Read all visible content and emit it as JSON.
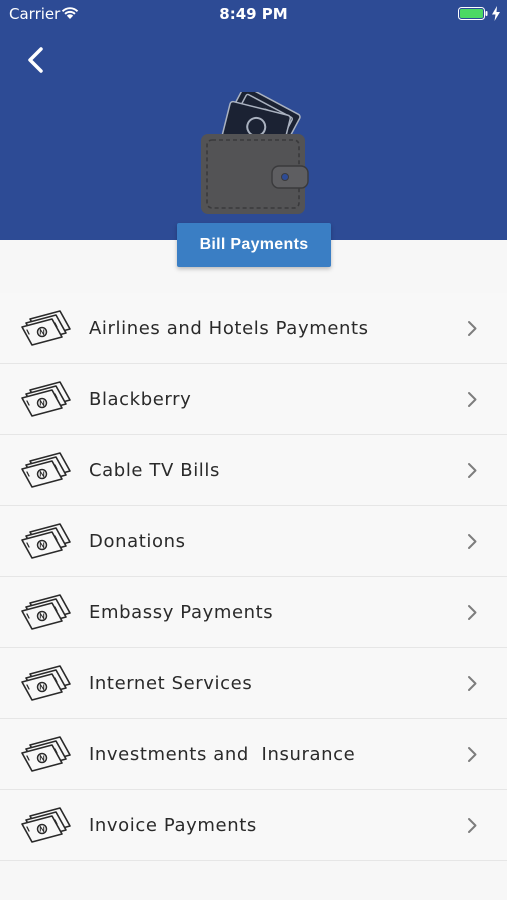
{
  "status_bar": {
    "carrier": "Carrier",
    "time": "8:49 PM",
    "battery_color": "#4cd964"
  },
  "header": {
    "background_color": "#2d4b95",
    "back_icon": "chevron-left-icon",
    "hero_icon": "wallet-icon",
    "title": "Bill Payments",
    "title_button_color": "#3a7ec4"
  },
  "list": {
    "item_icon": "money-bills-icon",
    "trailing_icon": "chevron-right-icon",
    "items": [
      {
        "label": "Airlines and Hotels Payments"
      },
      {
        "label": "Blackberry"
      },
      {
        "label": "Cable TV Bills"
      },
      {
        "label": "Donations"
      },
      {
        "label": "Embassy Payments"
      },
      {
        "label": "Internet Services"
      },
      {
        "label": "Investments and  Insurance"
      },
      {
        "label": "Invoice Payments"
      }
    ]
  }
}
